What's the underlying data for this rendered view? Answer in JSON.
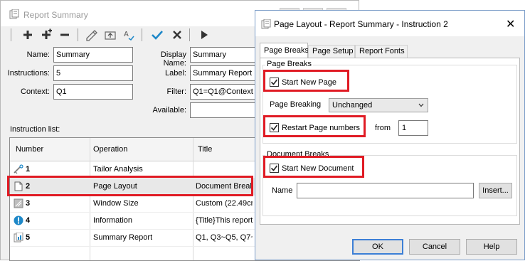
{
  "background_window": {
    "title": "Report Summary",
    "form": {
      "name_label": "Name:",
      "name_value": "Summary",
      "instructions_label": "Instructions:",
      "instructions_value": "5",
      "context_label": "Context:",
      "context_value": "Q1",
      "display_name_label": "Display Name:",
      "display_name_value": "Summary",
      "label_label": "Label:",
      "label_value": "Summary Report",
      "filter_label": "Filter:",
      "filter_value": "Q1=Q1@Context",
      "available_label": "Available:",
      "available_value": ""
    },
    "instruction_list_label": "Instruction list:",
    "columns": [
      "Number",
      "Operation",
      "Title"
    ],
    "rows": [
      {
        "number": "1",
        "operation": "Tailor Analysis",
        "title": "",
        "icon": "tailor-icon"
      },
      {
        "number": "2",
        "operation": "Page Layout",
        "title": "Document Break",
        "icon": "page-icon"
      },
      {
        "number": "3",
        "operation": "Window Size",
        "title": "Custom (22.49cm",
        "icon": "window-size-icon"
      },
      {
        "number": "4",
        "operation": "Information",
        "title": "{Title}This report",
        "icon": "info-icon"
      },
      {
        "number": "5",
        "operation": "Summary Report",
        "title": "Q1, Q3~Q5, Q7~",
        "icon": "summary-report-icon"
      }
    ]
  },
  "dialog": {
    "title": "Page Layout - Report Summary - Instruction 2",
    "tabs": [
      "Page Breaks",
      "Page Setup",
      "Report Fonts"
    ],
    "page_breaks_group": "Page Breaks",
    "start_new_page": "Start New Page",
    "page_breaking_label": "Page Breaking",
    "page_breaking_value": "Unchanged",
    "restart_page_numbers": "Restart Page numbers",
    "from_label": "from",
    "from_value": "1",
    "document_breaks_group": "Document Breaks",
    "start_new_document": "Start New Document",
    "name_label": "Name",
    "name_value": "",
    "insert_button": "Insert...",
    "ok_button": "OK",
    "cancel_button": "Cancel",
    "help_button": "Help"
  },
  "colors": {
    "highlight": "#e01b24",
    "check_accent": "#1e88c8",
    "default_button_border": "#3c7fd6"
  }
}
